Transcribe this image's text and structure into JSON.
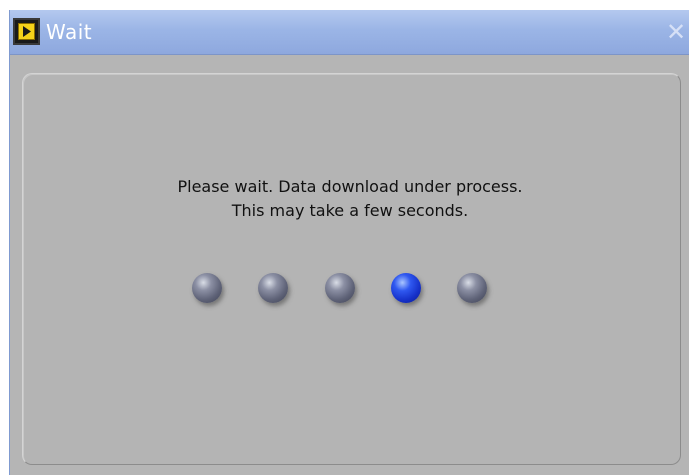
{
  "window": {
    "title": "Wait",
    "icon": "labview-vi-icon",
    "close_icon": "close-icon"
  },
  "message": {
    "line1": "Please wait. Data download under process.",
    "line2": "This may take a few seconds."
  },
  "progress_indicator": {
    "count": 5,
    "active_index": 3,
    "colors": {
      "inactive": "#5f6378",
      "active": "#1530c8"
    }
  }
}
